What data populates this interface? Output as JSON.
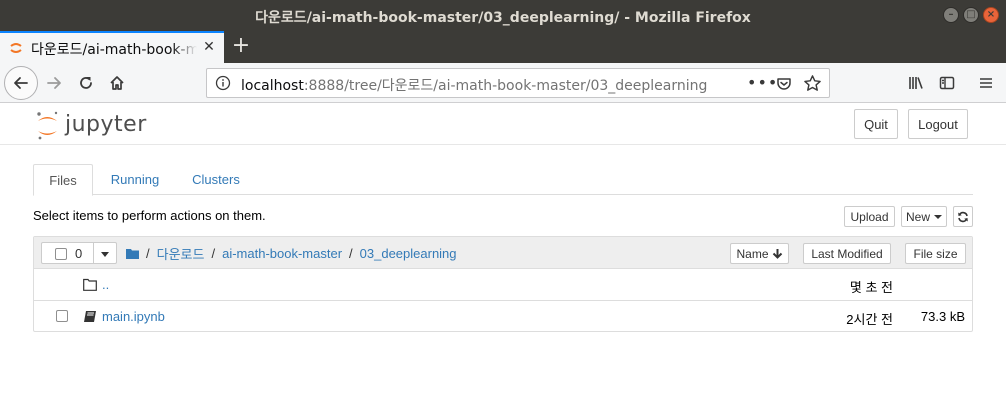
{
  "window": {
    "title": "다운로드/ai-math-book-master/03_deeplearning/ - Mozilla Firefox"
  },
  "browser": {
    "tab_label": "다운로드/ai-math-book-master/03_deeplearning",
    "url_host": "localhost",
    "url_rest": ":8888/tree/다운로드/ai-math-book-master/03_deeplearning",
    "url_menu": "•••"
  },
  "jupyter": {
    "logo_text": "jupyter",
    "quit_label": "Quit",
    "logout_label": "Logout",
    "tabs": [
      {
        "label": "Files",
        "active": true
      },
      {
        "label": "Running",
        "active": false
      },
      {
        "label": "Clusters",
        "active": false
      }
    ],
    "select_message": "Select items to perform actions on them.",
    "upload_label": "Upload",
    "new_label": "New",
    "selected_count": "0",
    "breadcrumb": [
      "다운로드",
      "ai-math-book-master",
      "03_deeplearning"
    ],
    "sort_name_label": "Name",
    "sort_modified_label": "Last Modified",
    "sort_size_label": "File size",
    "rows": [
      {
        "name": "..",
        "modified": "몇 초 전",
        "size": "",
        "type": "folder"
      },
      {
        "name": "main.ipynb",
        "modified": "2시간 전",
        "size": "73.3 kB",
        "type": "notebook"
      }
    ],
    "colors": {
      "link": "#337ab7",
      "accent_orange": "#f37726",
      "firefox_tab_accent": "#0a84ff"
    }
  },
  "icons": {
    "back": "back-arrow-icon",
    "forward": "forward-arrow-icon",
    "reload": "reload-icon",
    "home": "home-icon",
    "info": "info-icon",
    "pocket": "pocket-icon",
    "bookmark": "star-icon",
    "library": "library-icon",
    "sidebar": "sidebar-icon",
    "menu": "hamburger-menu-icon"
  }
}
